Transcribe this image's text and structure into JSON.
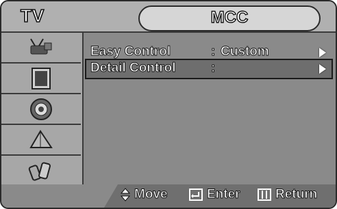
{
  "header": {
    "left_title": "TV",
    "center_title": "MCC"
  },
  "sidebar": {
    "items": [
      {
        "icon": "antenna-input-icon"
      },
      {
        "icon": "picture-frame-icon"
      },
      {
        "icon": "speaker-sound-icon"
      },
      {
        "icon": "channel-satellite-icon"
      },
      {
        "icon": "setup-tools-icon"
      }
    ]
  },
  "menu": {
    "items": [
      {
        "label": "Easy Control",
        "separator": ":",
        "value": "Custom",
        "selected": false
      },
      {
        "label": "Detail Control",
        "separator": ":",
        "value": "",
        "selected": true
      }
    ]
  },
  "footer": {
    "move_label": "Move",
    "enter_label": "Enter",
    "return_label": "Return"
  },
  "colors": {
    "background": "#8a8a8a",
    "text": "#ffffff",
    "outline": "#111111"
  }
}
